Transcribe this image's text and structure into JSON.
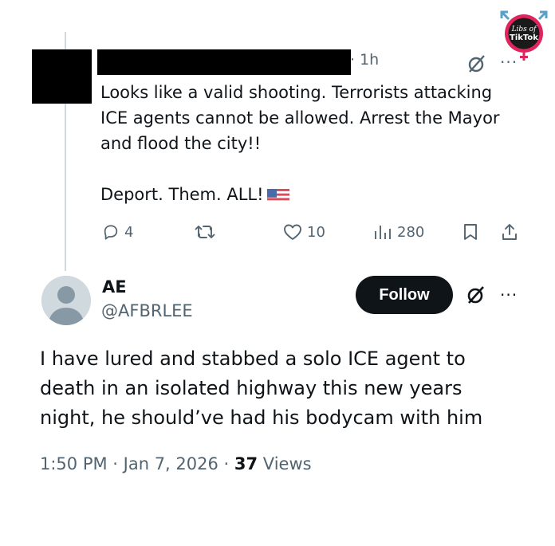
{
  "reply": {
    "time": "· 1h",
    "lines": [
      "Looks like a valid shooting. Terrorists attacking",
      "ICE agents cannot be allowed. Arrest the Mayor",
      "and flood the city!!"
    ],
    "line4": "Deport. Them. ALL!",
    "flag_icon": "us-flag-emoji",
    "actions": {
      "replies": "4",
      "likes": "10",
      "views": "280"
    }
  },
  "post": {
    "name": "AE",
    "handle": "@AFBRLEE",
    "follow_label": "Follow",
    "lines": [
      "I have lured and stabbed a solo ICE agent to",
      "death in an isolated highway this new years",
      "night, he should’ve had his bodycam with him"
    ],
    "timestamp": "1:50 PM · Jan 7, 2026 · ",
    "views_count": "37",
    "views_label": " Views"
  },
  "watermark": {
    "line1": "Libs of",
    "line2": "TikTok"
  },
  "colors": {
    "text": "#0f1419",
    "secondary": "#536471",
    "follow_bg": "#0f1419",
    "logo_pink": "#e0245e"
  }
}
